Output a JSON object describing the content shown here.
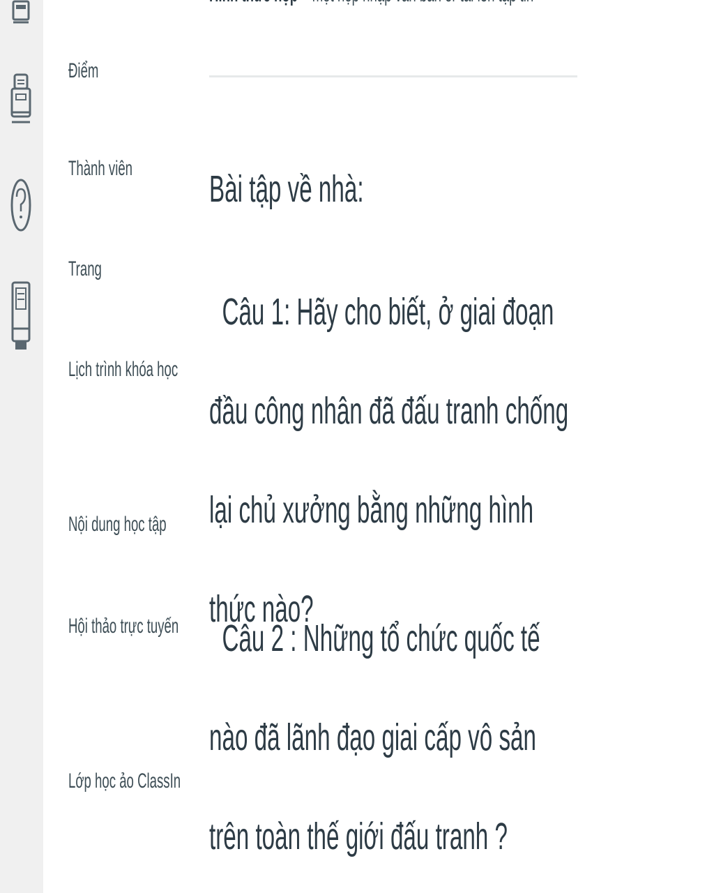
{
  "icon_rail": {
    "items": [
      {
        "icon": "inbox-icon"
      },
      {
        "icon": "history-icon"
      },
      {
        "icon": "help-icon"
      },
      {
        "icon": "commons-icon"
      }
    ]
  },
  "course_nav": {
    "items": [
      {
        "label": "Điểm"
      },
      {
        "label": "Thành viên"
      },
      {
        "label": "Trang"
      },
      {
        "label": "Lịch trình khóa học"
      },
      {
        "label": "Nội dung học tập"
      },
      {
        "label": "Hội thảo trực tuyến"
      },
      {
        "label": "Lớp học ảo ClassIn"
      }
    ]
  },
  "assignment": {
    "submission_label": "Hình thức nộp",
    "submission_value": "một hộp nhập văn bản or tải lên tập tin",
    "heading": "Bài tập về nhà:",
    "question1": "  Câu 1: Hãy cho biết, ở giai đoạn đầu công nhân đã đấu tranh chống lại chủ xưởng bằng những hình thức nào?",
    "question2": "  Câu 2 : Những tổ chức quốc tế nào đã lãnh đạo giai cấp vô sản trên toàn thế giới đấu tranh ?"
  },
  "colors": {
    "rail_bg": "#f0f0f0",
    "text": "#2d3b45",
    "nav_text": "#3d4d55",
    "divider": "#e6e9ea",
    "icon": "#5a6770"
  }
}
